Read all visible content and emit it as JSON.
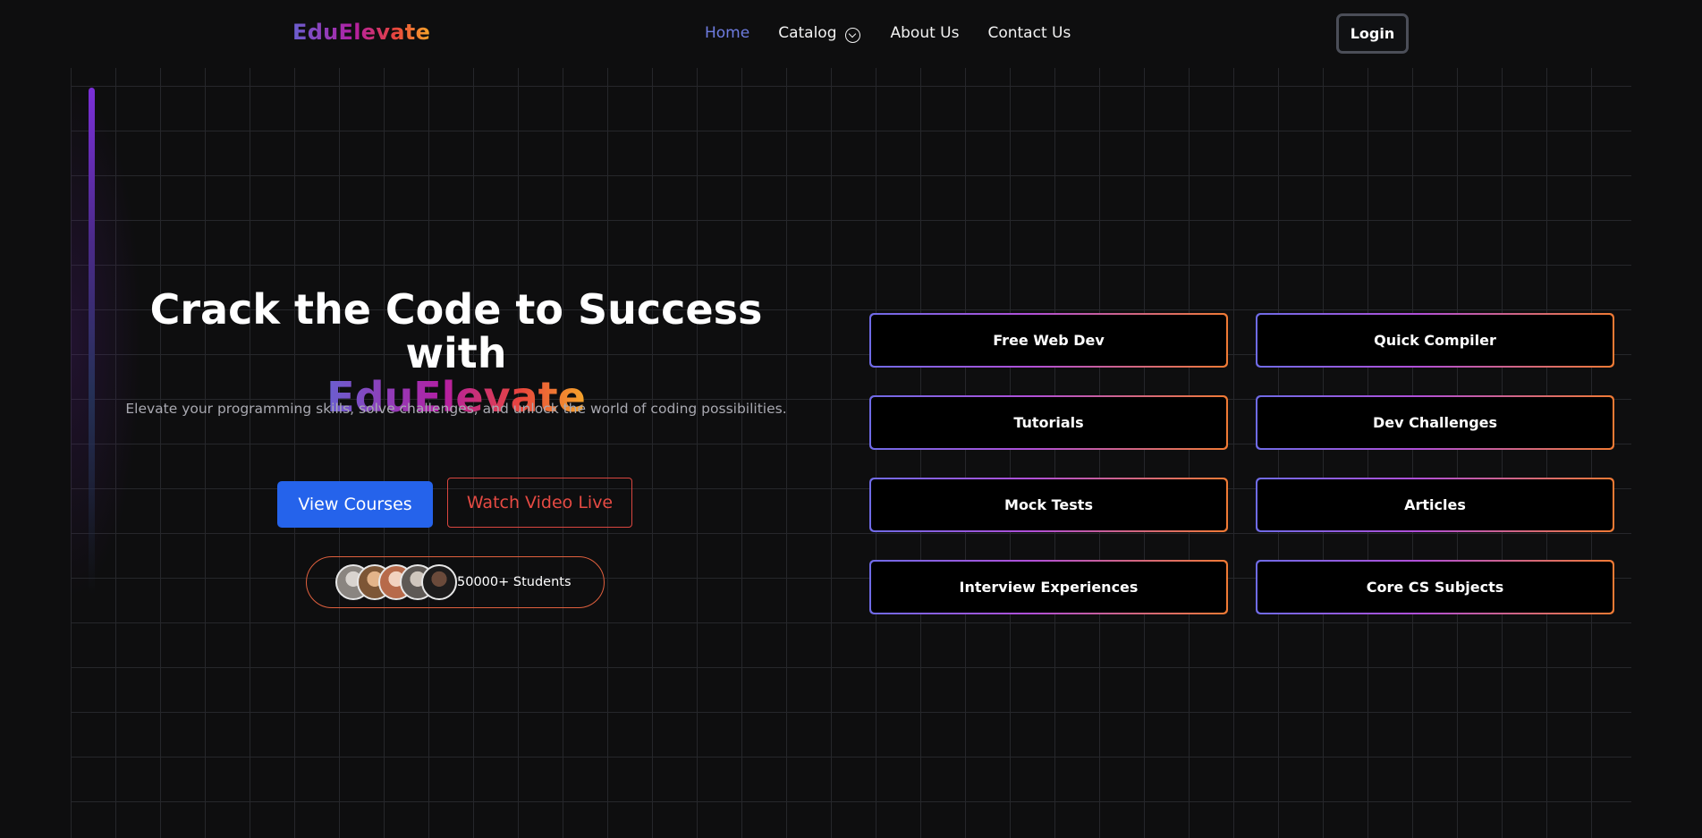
{
  "brand": {
    "name": "EduElevate"
  },
  "nav": {
    "home": "Home",
    "catalog": "Catalog",
    "about": "About Us",
    "contact": "Contact Us",
    "login": "Login"
  },
  "hero": {
    "title_line": "Crack the Code to Success with",
    "brand_name": "EduElevate",
    "subtitle": "Elevate your programming skills, solve challenges, and unlock the world of coding possibilities.",
    "primary_cta": "View Courses",
    "secondary_cta": "Watch Video Live",
    "students_label": "50000+ Students"
  },
  "features": [
    "Free Web Dev",
    "Quick Compiler",
    "Tutorials",
    "Dev Challenges",
    "Mock Tests",
    "Articles",
    "Interview Experiences",
    "Core CS Subjects"
  ],
  "colors": {
    "background": "#0e0e0f",
    "accent_blue": "#2563eb",
    "accent_red": "#e64a43",
    "nav_active": "#6e7ce0"
  }
}
